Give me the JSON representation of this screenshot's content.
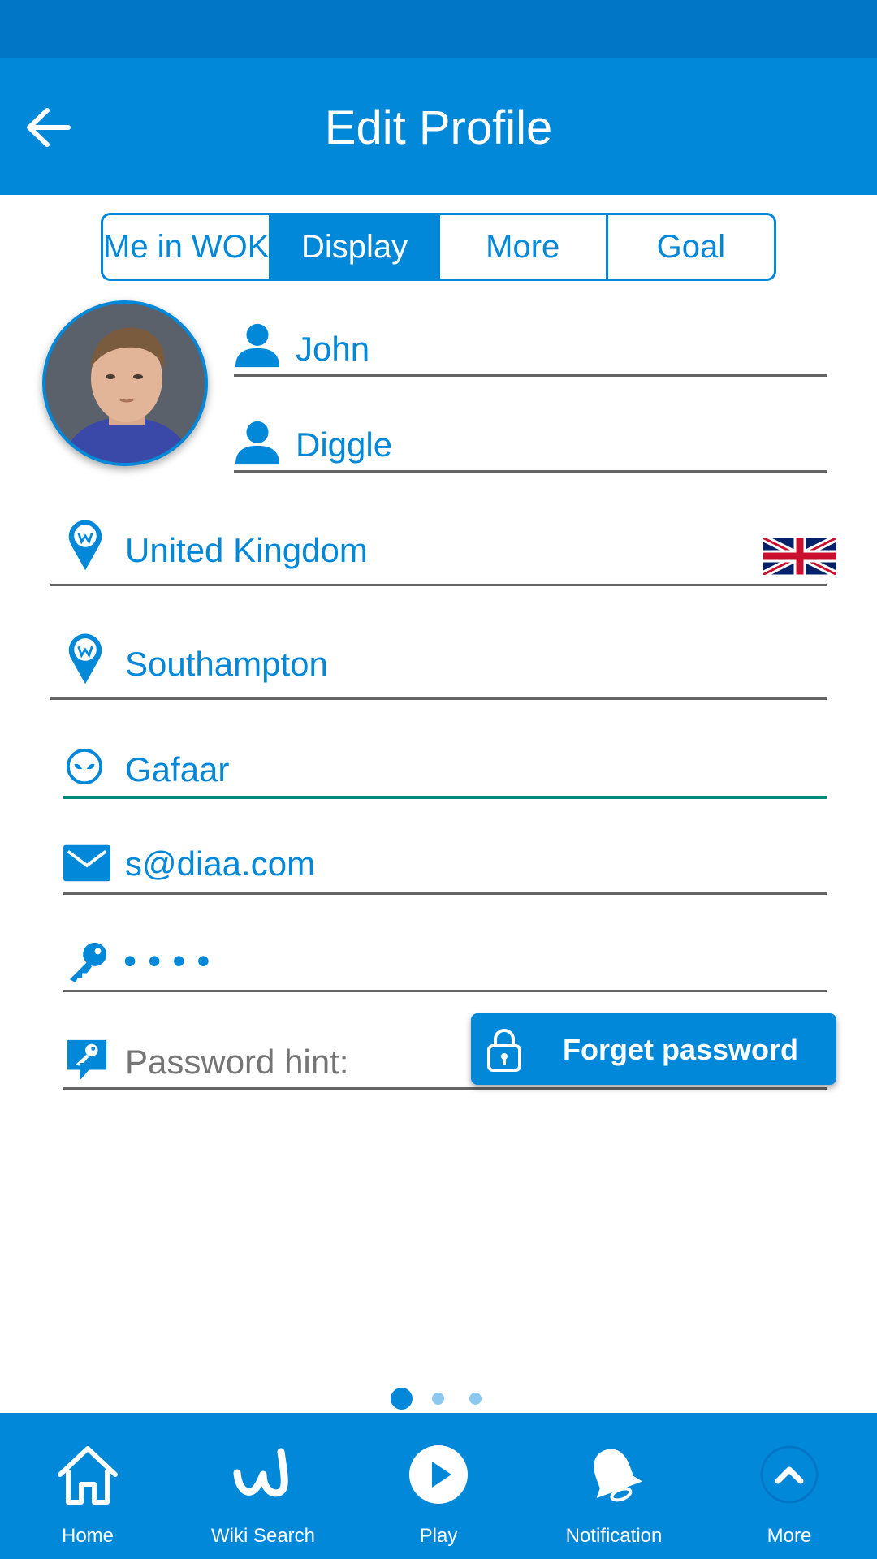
{
  "header": {
    "title": "Edit Profile"
  },
  "tabs": [
    {
      "label": "Me in WOK",
      "active": false
    },
    {
      "label": "Display",
      "active": true
    },
    {
      "label": "More",
      "active": false
    },
    {
      "label": "Goal",
      "active": false
    }
  ],
  "profile": {
    "first_name": "John",
    "last_name": "Diggle",
    "country": "United Kingdom",
    "city": "Southampton",
    "nickname": "Gafaar",
    "email": "s@diaa.com",
    "password_masked": "••••",
    "password_hint_placeholder": "Password hint:"
  },
  "forget_password_label": "Forget password",
  "pager": {
    "count": 3,
    "active": 0
  },
  "bottom_nav": [
    {
      "label": "Home",
      "icon": "home-icon"
    },
    {
      "label": "Wiki Search",
      "icon": "wiki-w-icon"
    },
    {
      "label": "Play",
      "icon": "play-icon"
    },
    {
      "label": "Notification",
      "icon": "bell-icon"
    },
    {
      "label": "More",
      "icon": "chevron-up-icon"
    }
  ],
  "colors": {
    "primary": "#0288D9",
    "status_bar": "#0276C6",
    "focus_line": "#00897B"
  }
}
